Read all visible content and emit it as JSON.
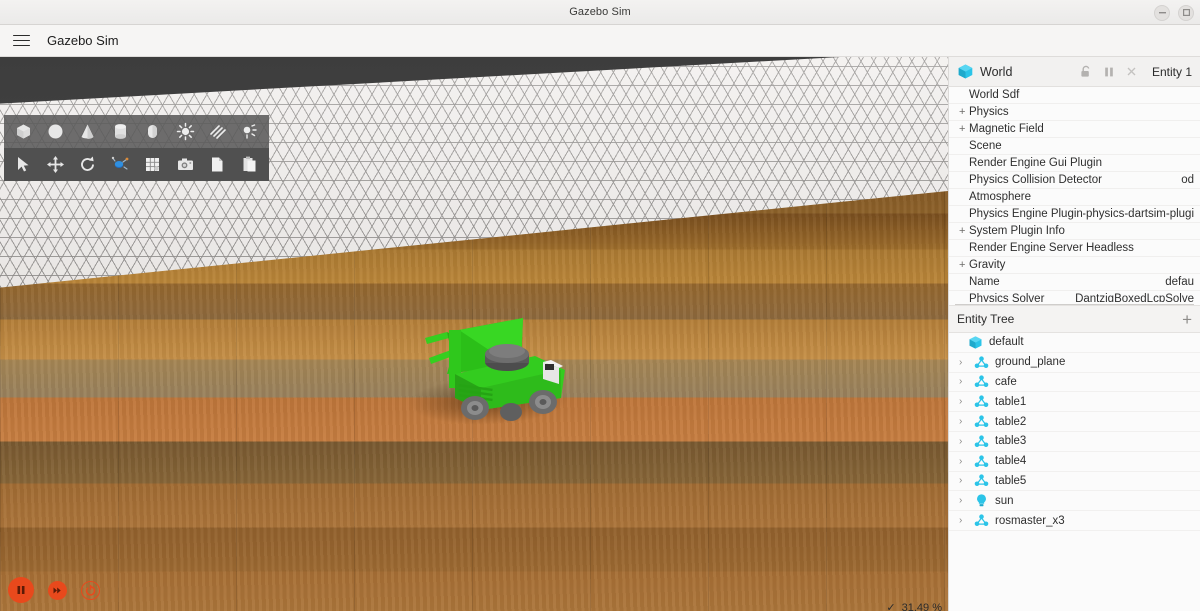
{
  "window": {
    "title": "Gazebo Sim",
    "controls": [
      {
        "name": "minimize-button",
        "glyph": "minimize"
      },
      {
        "name": "maximize-button",
        "glyph": "maximize"
      }
    ]
  },
  "menubar": {
    "hamburger_label": "menu-icon",
    "app_name": "Gazebo Sim"
  },
  "toolbar": {
    "row1": [
      {
        "name": "box-shape-tool",
        "label": "Box"
      },
      {
        "name": "sphere-shape-tool",
        "label": "Sphere"
      },
      {
        "name": "cone-shape-tool",
        "label": "Cone"
      },
      {
        "name": "cylinder-shape-tool",
        "label": "Cylinder"
      },
      {
        "name": "capsule-shape-tool",
        "label": "Capsule"
      },
      {
        "name": "point-light-tool",
        "label": "Point light"
      },
      {
        "name": "directional-light-tool",
        "label": "Directional light"
      },
      {
        "name": "spot-light-tool",
        "label": "Spot light"
      }
    ],
    "row2": [
      {
        "name": "select-mode-tool",
        "label": "Select"
      },
      {
        "name": "translate-mode-tool",
        "label": "Translate"
      },
      {
        "name": "rotate-mode-tool",
        "label": "Rotate"
      },
      {
        "name": "scale-mode-tool",
        "label": "Scale"
      },
      {
        "name": "grid-toggle-tool",
        "label": "Grid"
      },
      {
        "name": "screenshot-tool",
        "label": "Screenshot"
      },
      {
        "name": "copy-tool",
        "label": "Copy"
      },
      {
        "name": "paste-tool",
        "label": "Paste"
      }
    ]
  },
  "playback": {
    "pause_label": "Pause",
    "step_label": "Step",
    "reset_label": "Reset"
  },
  "statusbar": {
    "rtf_value": "31.49 %"
  },
  "dock": {
    "header": {
      "title": "World",
      "icon": "world-cube-icon",
      "lock_icon": "lock-open-icon",
      "pause_icon": "pause-icon",
      "close_icon": "close-icon",
      "entity_label": "Entity 1"
    },
    "properties": [
      {
        "name": "World Sdf",
        "value": "",
        "expandable": false
      },
      {
        "name": "Physics",
        "value": "",
        "expandable": true
      },
      {
        "name": "Magnetic Field",
        "value": "",
        "expandable": true
      },
      {
        "name": "Scene",
        "value": "",
        "expandable": false
      },
      {
        "name": "Render Engine Gui Plugin",
        "value": "",
        "expandable": false
      },
      {
        "name": "Physics Collision Detector",
        "value": "od",
        "expandable": false
      },
      {
        "name": "Atmosphere",
        "value": "",
        "expandable": false
      },
      {
        "name": "Physics Engine Plugin",
        "value": "gz-physics-dartsim-plugi",
        "expandable": false
      },
      {
        "name": "System Plugin Info",
        "value": "",
        "expandable": true
      },
      {
        "name": "Render Engine Server Headless",
        "value": "",
        "expandable": false
      },
      {
        "name": "Gravity",
        "value": "",
        "expandable": true
      },
      {
        "name": "Name",
        "value": "defau",
        "expandable": false
      },
      {
        "name": "Physics Solver",
        "value": "DantzigBoxedLcpSolve",
        "expandable": false
      }
    ],
    "entity_tree": {
      "title": "Entity Tree",
      "add_label": "+",
      "items": [
        {
          "label": "default",
          "icon": "world-cube-icon",
          "expandable": false,
          "depth": 0
        },
        {
          "label": "ground_plane",
          "icon": "model-icon",
          "expandable": true,
          "depth": 1
        },
        {
          "label": "cafe",
          "icon": "model-icon",
          "expandable": true,
          "depth": 1
        },
        {
          "label": "table1",
          "icon": "model-icon",
          "expandable": true,
          "depth": 1
        },
        {
          "label": "table2",
          "icon": "model-icon",
          "expandable": true,
          "depth": 1
        },
        {
          "label": "table3",
          "icon": "model-icon",
          "expandable": true,
          "depth": 1
        },
        {
          "label": "table4",
          "icon": "model-icon",
          "expandable": true,
          "depth": 1
        },
        {
          "label": "table5",
          "icon": "model-icon",
          "expandable": true,
          "depth": 1
        },
        {
          "label": "sun",
          "icon": "light-bulb-icon",
          "expandable": true,
          "depth": 1
        },
        {
          "label": "rosmaster_x3",
          "icon": "model-icon",
          "expandable": true,
          "depth": 1
        }
      ]
    }
  },
  "viewport": {
    "scene_name": "3d-scene",
    "robot_name": "rosmaster_x3",
    "colors": {
      "robot_green": "#2fcc1f",
      "accent_orange": "#e8491c",
      "tree_icon_cyan": "#2bc4e8",
      "floor_wood": "#a9752f",
      "tile_white": "#e9e6e4"
    }
  }
}
